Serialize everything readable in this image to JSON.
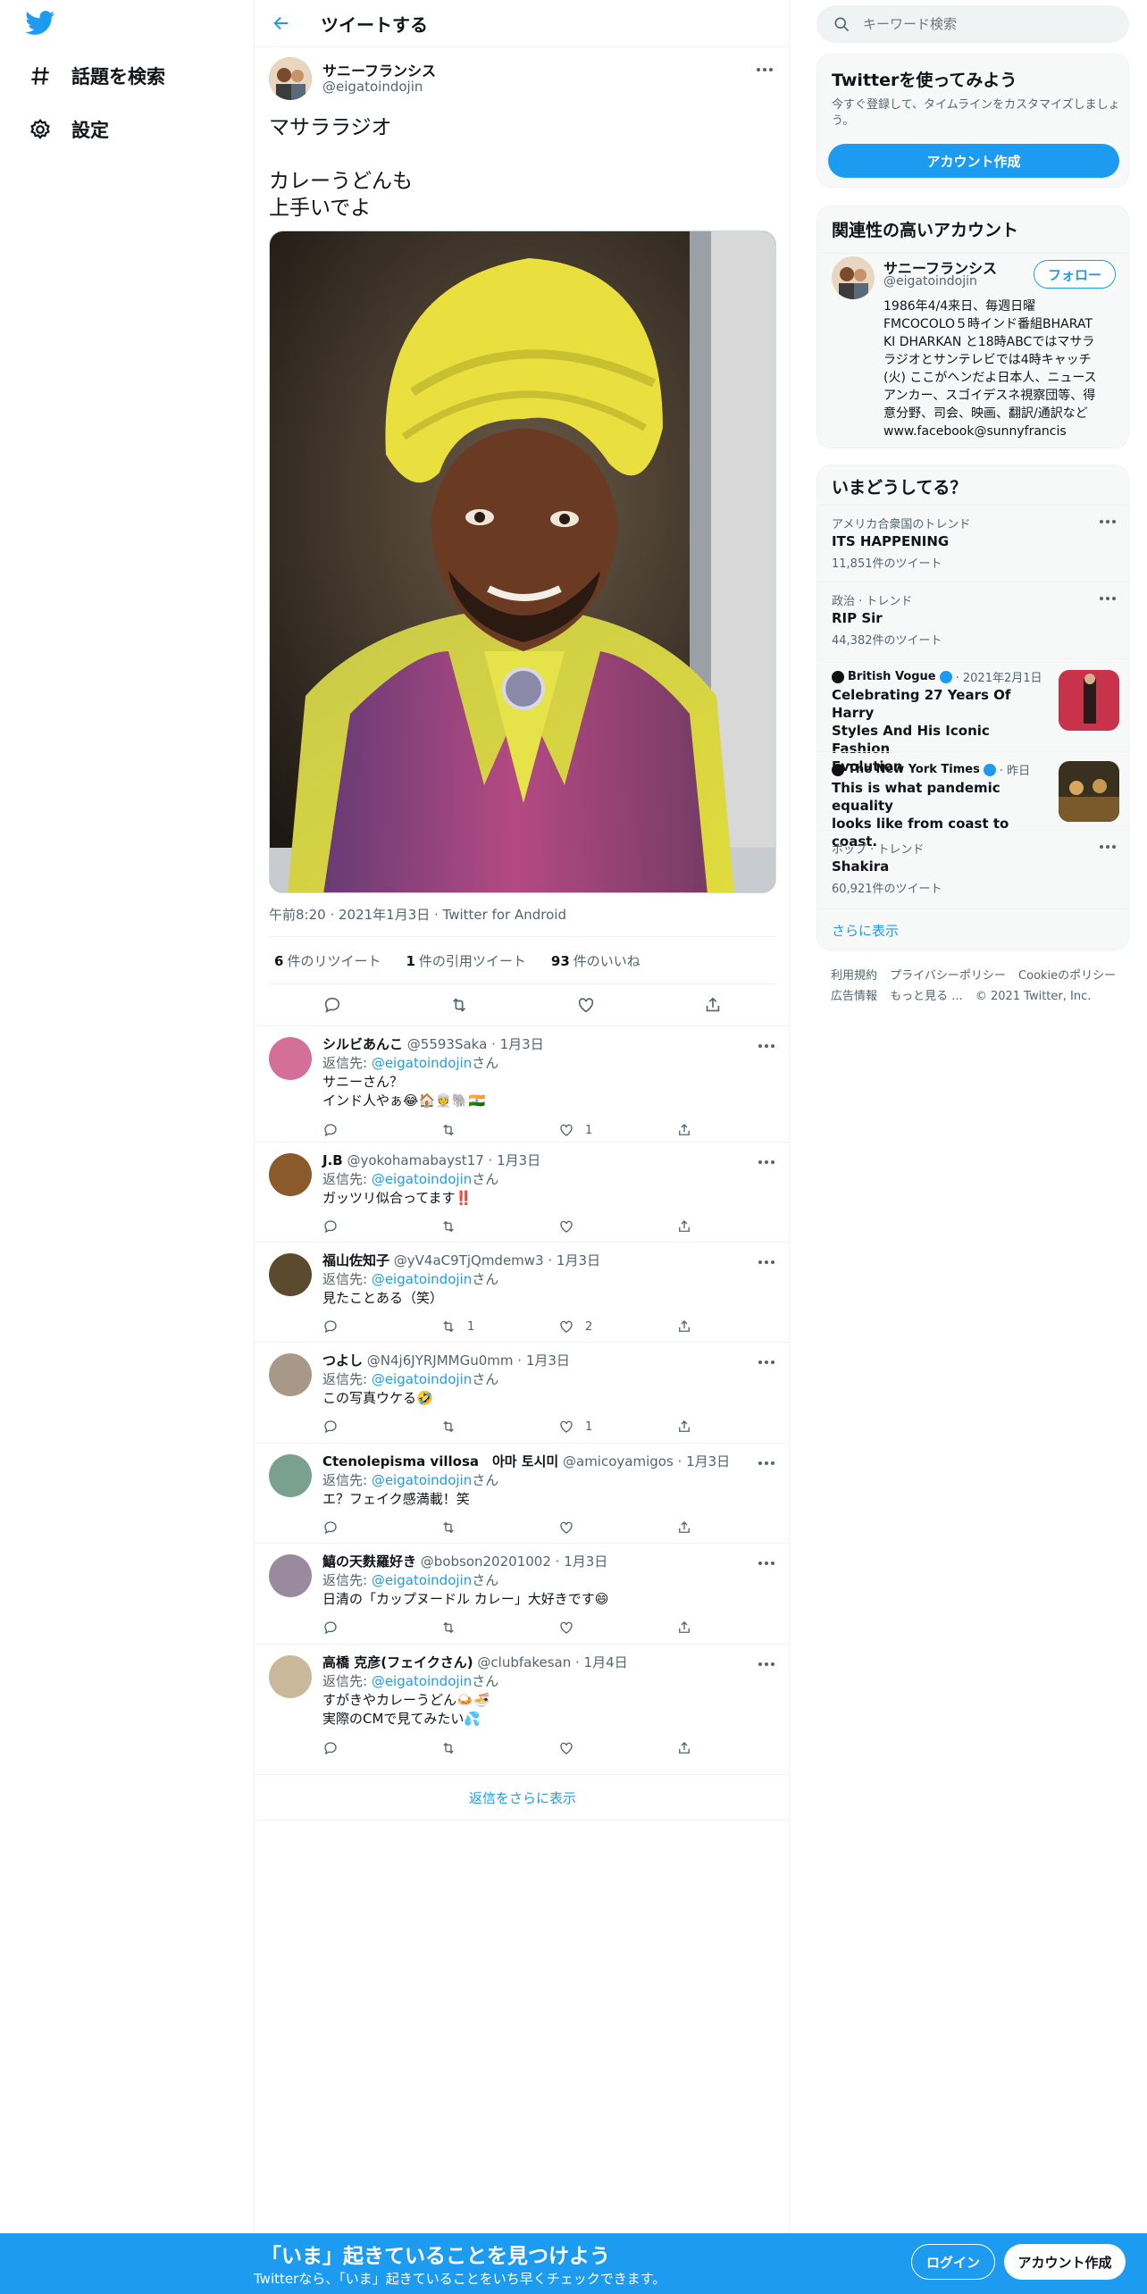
{
  "nav": {
    "explore_label": "話題を検索",
    "settings_label": "設定"
  },
  "header": {
    "title": "ツイートする"
  },
  "tweet": {
    "author_name": "サニーフランシス",
    "author_handle": "@eigatoindojin",
    "text_line1": "マサララジオ",
    "text_line2": "カレーうどんも",
    "text_line3": "上手いでよ",
    "timestamp": "午前8:20 · 2021年1月3日 · Twitter for Android",
    "retweets_count": "6",
    "retweets_label": "件のリツイート",
    "quotes_count": "1",
    "quotes_label": "件の引用ツイート",
    "likes_count": "93",
    "likes_label": "件のいいね"
  },
  "replies": [
    {
      "name": "シルビあんこ",
      "handle": "@5593Saka",
      "date": "· 1月3日",
      "reply_prefix": "返信先: ",
      "reply_to": "@eigatoindojin",
      "reply_suffix": "さん",
      "line1": "サニーさん？",
      "line2": "インド人やぁ😂🏠👳🐘🇮🇳",
      "retweets": "",
      "likes": "1",
      "avatar_color": "#d46f9a"
    },
    {
      "name": "J.B",
      "handle": "@yokohamabayst17",
      "date": "· 1月3日",
      "reply_prefix": "返信先: ",
      "reply_to": "@eigatoindojin",
      "reply_suffix": "さん",
      "line1": "ガッツリ似合ってます‼️",
      "line2": "",
      "retweets": "",
      "likes": "",
      "avatar_color": "#8a5a2b"
    },
    {
      "name": "福山佐知子",
      "handle": "@yV4aC9TjQmdemw3",
      "date": "· 1月3日",
      "reply_prefix": "返信先: ",
      "reply_to": "@eigatoindojin",
      "reply_suffix": "さん",
      "line1": "見たことある（笑）",
      "line2": "",
      "retweets": "1",
      "likes": "2",
      "avatar_color": "#5b4a2e"
    },
    {
      "name": "つよし",
      "handle": "@N4j6JYRJMMGu0mm",
      "date": "· 1月3日",
      "reply_prefix": "返信先: ",
      "reply_to": "@eigatoindojin",
      "reply_suffix": "さん",
      "line1": "この写真ウケる🤣",
      "line2": "",
      "retweets": "",
      "likes": "1",
      "avatar_color": "#a89888"
    },
    {
      "name": "Ctenolepisma villosa　아마 토시미",
      "handle": "@amicoyamigos",
      "date": "· 1月3日",
      "reply_prefix": "返信先: ",
      "reply_to": "@eigatoindojin",
      "reply_suffix": "さん",
      "line1": "エ？フェイク感満載！笑",
      "line2": "",
      "retweets": "",
      "likes": "",
      "avatar_color": "#7aa090"
    },
    {
      "name": "鱚の天麩羅好き",
      "handle": "@bobson20201002",
      "date": "· 1月3日",
      "reply_prefix": "返信先: ",
      "reply_to": "@eigatoindojin",
      "reply_suffix": "さん",
      "line1": "日清の「カップヌードル カレー」大好きです😄",
      "line2": "",
      "retweets": "",
      "likes": "",
      "avatar_color": "#9a8aa0"
    },
    {
      "name": "高橋 克彦(フェイクさん)",
      "handle": "@clubfakesan",
      "date": "· 1月4日",
      "reply_prefix": "返信先: ",
      "reply_to": "@eigatoindojin",
      "reply_suffix": "さん",
      "line1": "すがきやカレーうどん🍛🍜",
      "line2": "実際のCMで見てみたい💦",
      "retweets": "",
      "likes": "",
      "avatar_color": "#c9b89a"
    }
  ],
  "show_more_replies": "返信をさらに表示",
  "search": {
    "placeholder": "キーワード検索"
  },
  "signup_card": {
    "title": "Twitterを使ってみよう",
    "desc_line1": "今すぐ登録して、タイムラインをカスタマイズしましょ",
    "desc_line2": "う。",
    "button": "アカウント作成"
  },
  "related": {
    "title": "関連性の高いアカウント",
    "name": "サニーフランシス",
    "handle": "@eigatoindojin",
    "follow": "フォロー",
    "bio": [
      "1986年4/4来日、毎週日曜",
      "FMCOCOLO５時インド番組BHARAT",
      "KI DHARKAN と18時ABCではマサラ",
      "ラジオとサンテレビでは4時キャッチ",
      "(火) ここがヘンだよ日本人、ニュース",
      "アンカー、スゴイデスネ視察団等、得",
      "意分野、司会、映画、翻訳/通訳など",
      "www.facebook@sunnyfrancis"
    ]
  },
  "trends": {
    "title": "いまどうしてる？",
    "items": [
      {
        "context": "アメリカ合衆国のトレンド",
        "title": "ITS HAPPENING",
        "count": "11,851件のツイート"
      },
      {
        "context": "政治 · トレンド",
        "title": "RIP Sir",
        "count": "44,382件のツイート"
      },
      {
        "source": "British Vogue",
        "date": "· 2021年2月1日",
        "title_lines": [
          "Celebrating 27 Years Of Harry",
          "Styles And His Iconic Fashion",
          "Evolution"
        ]
      },
      {
        "source": "The New York Times",
        "date": "· 昨日",
        "title_lines": [
          "This is what pandemic equality",
          "looks like from coast to coast."
        ]
      },
      {
        "context": "ポップ · トレンド",
        "title": "Shakira",
        "count": "60,921件のツイート"
      }
    ],
    "show_more": "さらに表示"
  },
  "footer": {
    "links1": [
      "利用規約",
      "プライバシーポリシー",
      "Cookieのポリシー"
    ],
    "links2": [
      "広告情報",
      "もっと見る ...",
      "© 2021 Twitter, Inc."
    ]
  },
  "bottom_bar": {
    "headline": "「いま」起きていることを見つけよう",
    "sub": "Twitterなら、「いま」起きていることをいち早くチェックできます。",
    "login": "ログイン",
    "signup": "アカウント作成"
  },
  "colors": {
    "accent": "#1d9bf0",
    "text": "#0f1419",
    "muted": "#536471",
    "border": "#eff3f4"
  }
}
